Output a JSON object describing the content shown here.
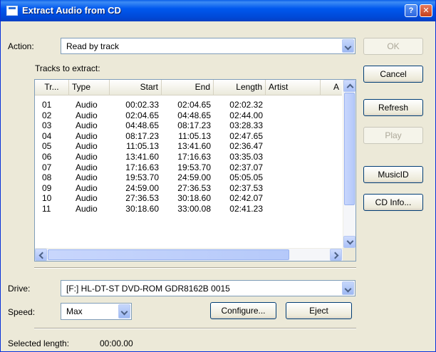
{
  "window": {
    "title": "Extract Audio from CD",
    "help_button": "?",
    "close_button": "✕"
  },
  "action": {
    "label": "Action:",
    "value": "Read by track"
  },
  "tracks": {
    "label": "Tracks to extract:",
    "columns": [
      "Tr...",
      "Type",
      "Start",
      "End",
      "Length",
      "Artist",
      "A"
    ],
    "rows": [
      [
        "01",
        "Audio",
        "00:02.33",
        "02:04.65",
        "02:02.32"
      ],
      [
        "02",
        "Audio",
        "02:04.65",
        "04:48.65",
        "02:44.00"
      ],
      [
        "03",
        "Audio",
        "04:48.65",
        "08:17.23",
        "03:28.33"
      ],
      [
        "04",
        "Audio",
        "08:17.23",
        "11:05.13",
        "02:47.65"
      ],
      [
        "05",
        "Audio",
        "11:05.13",
        "13:41.60",
        "02:36.47"
      ],
      [
        "06",
        "Audio",
        "13:41.60",
        "17:16.63",
        "03:35.03"
      ],
      [
        "07",
        "Audio",
        "17:16.63",
        "19:53.70",
        "02:37.07"
      ],
      [
        "08",
        "Audio",
        "19:53.70",
        "24:59.00",
        "05:05.05"
      ],
      [
        "09",
        "Audio",
        "24:59.00",
        "27:36.53",
        "02:37.53"
      ],
      [
        "10",
        "Audio",
        "27:36.53",
        "30:18.60",
        "02:42.07"
      ],
      [
        "11",
        "Audio",
        "30:18.60",
        "33:00.08",
        "02:41.23"
      ]
    ]
  },
  "buttons": {
    "ok": "OK",
    "cancel": "Cancel",
    "refresh": "Refresh",
    "play": "Play",
    "musicid": "MusicID",
    "cdinfo": "CD Info...",
    "configure": "Configure...",
    "eject": "Eject"
  },
  "drive": {
    "label": "Drive:",
    "value": "[F:] HL-DT-ST DVD-ROM GDR8162B 0015"
  },
  "speed": {
    "label": "Speed:",
    "value": "Max"
  },
  "status": {
    "selected_length_label": "Selected length:",
    "selected_length_value": "00:00.00"
  }
}
